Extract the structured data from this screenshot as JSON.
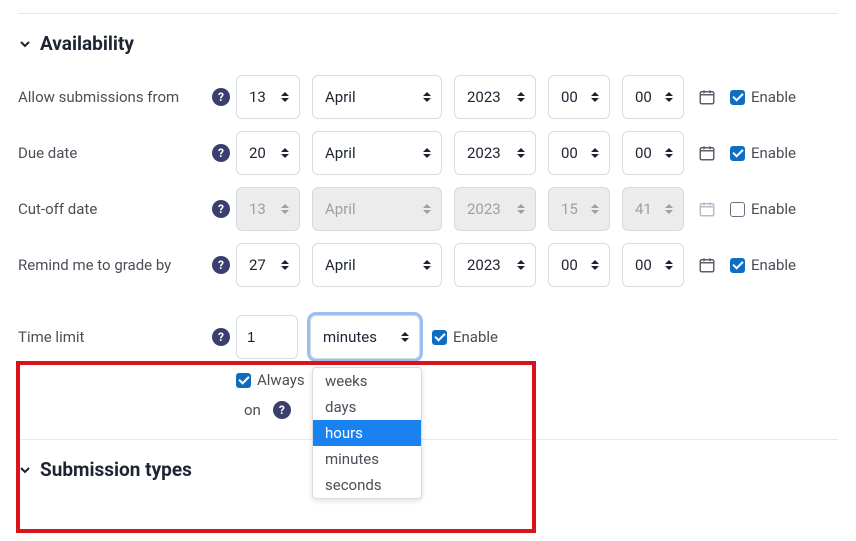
{
  "sections": {
    "availability_title": "Availability",
    "submission_types_title": "Submission types"
  },
  "enable_label": "Enable",
  "rows": {
    "allow_from": {
      "label": "Allow submissions from",
      "day": "13",
      "month": "April",
      "year": "2023",
      "hour": "00",
      "min": "00",
      "enabled": true
    },
    "due_date": {
      "label": "Due date",
      "day": "20",
      "month": "April",
      "year": "2023",
      "hour": "00",
      "min": "00",
      "enabled": true
    },
    "cutoff": {
      "label": "Cut-off date",
      "day": "13",
      "month": "April",
      "year": "2023",
      "hour": "15",
      "min": "41",
      "enabled": false
    },
    "remind": {
      "label": "Remind me to grade by",
      "day": "27",
      "month": "April",
      "year": "2023",
      "hour": "00",
      "min": "00",
      "enabled": true
    },
    "timelimit": {
      "label": "Time limit",
      "value": "1",
      "unit": "minutes",
      "enabled": true
    },
    "always_show": {
      "label_full": "Always show description",
      "label_before": "Always",
      "label_after": "on",
      "checked": true
    }
  },
  "unit_options": [
    "weeks",
    "days",
    "hours",
    "minutes",
    "seconds"
  ],
  "unit_hovered": "hours"
}
